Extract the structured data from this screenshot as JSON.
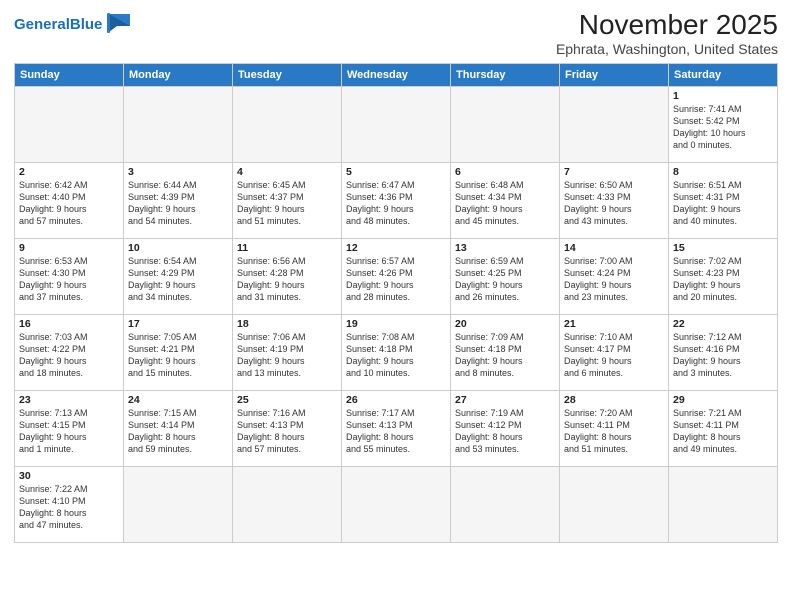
{
  "logo": {
    "text_general": "General",
    "text_blue": "Blue"
  },
  "title": "November 2025",
  "subtitle": "Ephrata, Washington, United States",
  "weekdays": [
    "Sunday",
    "Monday",
    "Tuesday",
    "Wednesday",
    "Thursday",
    "Friday",
    "Saturday"
  ],
  "days": [
    {
      "num": "",
      "info": ""
    },
    {
      "num": "",
      "info": ""
    },
    {
      "num": "",
      "info": ""
    },
    {
      "num": "",
      "info": ""
    },
    {
      "num": "",
      "info": ""
    },
    {
      "num": "",
      "info": ""
    },
    {
      "num": "1",
      "info": "Sunrise: 7:41 AM\nSunset: 5:42 PM\nDaylight: 10 hours\nand 0 minutes."
    },
    {
      "num": "2",
      "info": "Sunrise: 6:42 AM\nSunset: 4:40 PM\nDaylight: 9 hours\nand 57 minutes."
    },
    {
      "num": "3",
      "info": "Sunrise: 6:44 AM\nSunset: 4:39 PM\nDaylight: 9 hours\nand 54 minutes."
    },
    {
      "num": "4",
      "info": "Sunrise: 6:45 AM\nSunset: 4:37 PM\nDaylight: 9 hours\nand 51 minutes."
    },
    {
      "num": "5",
      "info": "Sunrise: 6:47 AM\nSunset: 4:36 PM\nDaylight: 9 hours\nand 48 minutes."
    },
    {
      "num": "6",
      "info": "Sunrise: 6:48 AM\nSunset: 4:34 PM\nDaylight: 9 hours\nand 45 minutes."
    },
    {
      "num": "7",
      "info": "Sunrise: 6:50 AM\nSunset: 4:33 PM\nDaylight: 9 hours\nand 43 minutes."
    },
    {
      "num": "8",
      "info": "Sunrise: 6:51 AM\nSunset: 4:31 PM\nDaylight: 9 hours\nand 40 minutes."
    },
    {
      "num": "9",
      "info": "Sunrise: 6:53 AM\nSunset: 4:30 PM\nDaylight: 9 hours\nand 37 minutes."
    },
    {
      "num": "10",
      "info": "Sunrise: 6:54 AM\nSunset: 4:29 PM\nDaylight: 9 hours\nand 34 minutes."
    },
    {
      "num": "11",
      "info": "Sunrise: 6:56 AM\nSunset: 4:28 PM\nDaylight: 9 hours\nand 31 minutes."
    },
    {
      "num": "12",
      "info": "Sunrise: 6:57 AM\nSunset: 4:26 PM\nDaylight: 9 hours\nand 28 minutes."
    },
    {
      "num": "13",
      "info": "Sunrise: 6:59 AM\nSunset: 4:25 PM\nDaylight: 9 hours\nand 26 minutes."
    },
    {
      "num": "14",
      "info": "Sunrise: 7:00 AM\nSunset: 4:24 PM\nDaylight: 9 hours\nand 23 minutes."
    },
    {
      "num": "15",
      "info": "Sunrise: 7:02 AM\nSunset: 4:23 PM\nDaylight: 9 hours\nand 20 minutes."
    },
    {
      "num": "16",
      "info": "Sunrise: 7:03 AM\nSunset: 4:22 PM\nDaylight: 9 hours\nand 18 minutes."
    },
    {
      "num": "17",
      "info": "Sunrise: 7:05 AM\nSunset: 4:21 PM\nDaylight: 9 hours\nand 15 minutes."
    },
    {
      "num": "18",
      "info": "Sunrise: 7:06 AM\nSunset: 4:19 PM\nDaylight: 9 hours\nand 13 minutes."
    },
    {
      "num": "19",
      "info": "Sunrise: 7:08 AM\nSunset: 4:18 PM\nDaylight: 9 hours\nand 10 minutes."
    },
    {
      "num": "20",
      "info": "Sunrise: 7:09 AM\nSunset: 4:18 PM\nDaylight: 9 hours\nand 8 minutes."
    },
    {
      "num": "21",
      "info": "Sunrise: 7:10 AM\nSunset: 4:17 PM\nDaylight: 9 hours\nand 6 minutes."
    },
    {
      "num": "22",
      "info": "Sunrise: 7:12 AM\nSunset: 4:16 PM\nDaylight: 9 hours\nand 3 minutes."
    },
    {
      "num": "23",
      "info": "Sunrise: 7:13 AM\nSunset: 4:15 PM\nDaylight: 9 hours\nand 1 minute."
    },
    {
      "num": "24",
      "info": "Sunrise: 7:15 AM\nSunset: 4:14 PM\nDaylight: 8 hours\nand 59 minutes."
    },
    {
      "num": "25",
      "info": "Sunrise: 7:16 AM\nSunset: 4:13 PM\nDaylight: 8 hours\nand 57 minutes."
    },
    {
      "num": "26",
      "info": "Sunrise: 7:17 AM\nSunset: 4:13 PM\nDaylight: 8 hours\nand 55 minutes."
    },
    {
      "num": "27",
      "info": "Sunrise: 7:19 AM\nSunset: 4:12 PM\nDaylight: 8 hours\nand 53 minutes."
    },
    {
      "num": "28",
      "info": "Sunrise: 7:20 AM\nSunset: 4:11 PM\nDaylight: 8 hours\nand 51 minutes."
    },
    {
      "num": "29",
      "info": "Sunrise: 7:21 AM\nSunset: 4:11 PM\nDaylight: 8 hours\nand 49 minutes."
    },
    {
      "num": "30",
      "info": "Sunrise: 7:22 AM\nSunset: 4:10 PM\nDaylight: 8 hours\nand 47 minutes."
    },
    {
      "num": "",
      "info": ""
    },
    {
      "num": "",
      "info": ""
    },
    {
      "num": "",
      "info": ""
    },
    {
      "num": "",
      "info": ""
    },
    {
      "num": "",
      "info": ""
    },
    {
      "num": "",
      "info": ""
    }
  ]
}
